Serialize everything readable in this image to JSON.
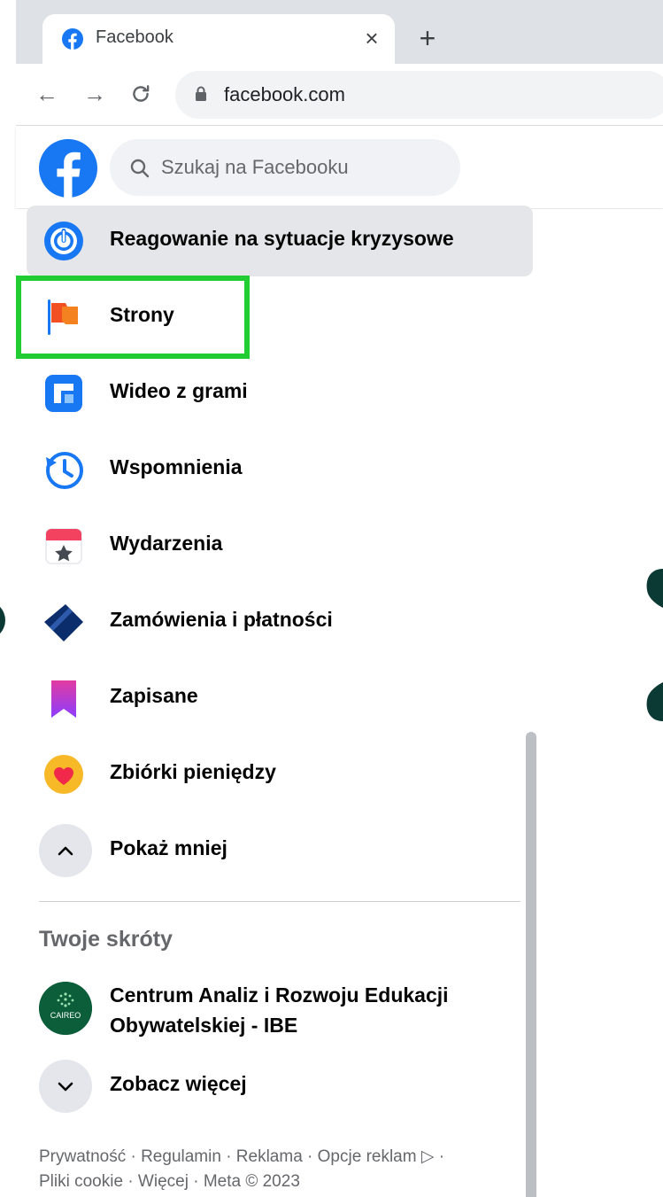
{
  "browser": {
    "tab_title": "Facebook",
    "tab_close": "×",
    "new_tab": "+",
    "back": "←",
    "forward": "→",
    "reload": "C",
    "url": "facebook.com"
  },
  "header": {
    "search_placeholder": "Szukaj na Facebooku"
  },
  "menu": {
    "items": [
      {
        "label": "Reagowanie na sytuacje kryzysowe",
        "icon": "crisis-response-icon"
      },
      {
        "label": "Strony",
        "icon": "pages-flag-icon"
      },
      {
        "label": "Wideo z grami",
        "icon": "gaming-video-icon"
      },
      {
        "label": "Wspomnienia",
        "icon": "memories-clock-icon"
      },
      {
        "label": "Wydarzenia",
        "icon": "events-calendar-icon"
      },
      {
        "label": "Zamówienia i płatności",
        "icon": "orders-payments-card-icon"
      },
      {
        "label": "Zapisane",
        "icon": "saved-bookmark-icon"
      },
      {
        "label": "Zbiórki pieniędzy",
        "icon": "fundraisers-heart-icon"
      }
    ],
    "show_less": "Pokaż mniej"
  },
  "shortcuts": {
    "title": "Twoje skróty",
    "items": [
      {
        "line1": "Centrum Analiz i Rozwoju Edukacji",
        "line2": "Obywatelskiej - IBE",
        "avatar_text": "CAIREO"
      }
    ],
    "see_more": "Zobacz więcej"
  },
  "footer": {
    "line1": "Prywatność · Regulamin · Reklama · Opcje reklam ▷ ·",
    "line2": "Pliki cookie · Więcej · Meta © 2023"
  },
  "colors": {
    "fb_blue": "#1877f2",
    "highlight_green": "#22cc33",
    "active_bg": "#e4e6e9",
    "blob_dark_teal": "#0b3a35"
  }
}
